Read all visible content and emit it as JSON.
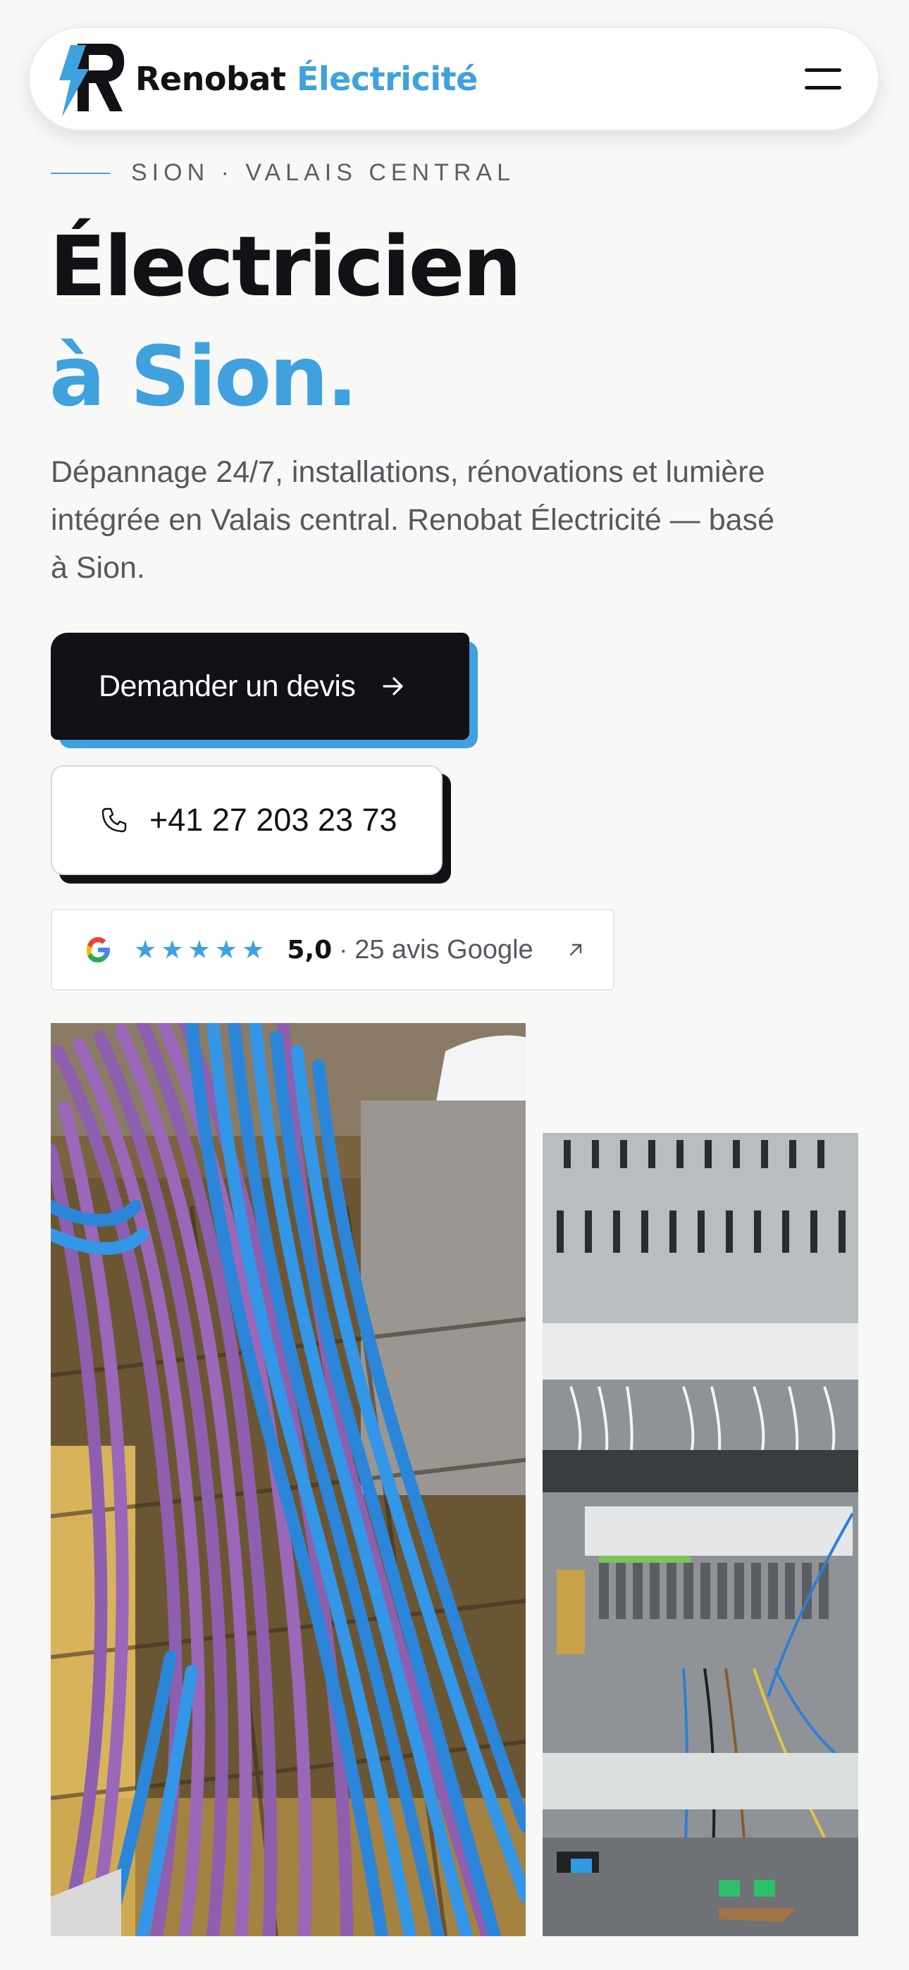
{
  "header": {
    "brand_part1": "Renobat",
    "brand_part2": "Électricité",
    "logo_icon": "lightning-r-logo",
    "menu_icon": "hamburger-icon"
  },
  "hero": {
    "eyebrow": "SION · VALAIS CENTRAL",
    "title_line1": "Électricien",
    "title_line2": "à Sion.",
    "lead": "Dépannage 24/7, installations, rénovations et lumière intégrée en Valais central. Renobat Électricité — basé à Sion.",
    "cta_label": "Demander un devis",
    "cta_icon": "arrow-right-icon",
    "phone_label": "+41 27 203 23 73",
    "phone_icon": "phone-icon"
  },
  "reviews": {
    "google_icon": "google-g-icon",
    "stars": 5,
    "rating": "5,0",
    "separator": "·",
    "count_label": "25 avis Google",
    "external_icon": "arrow-up-right-icon"
  },
  "colors": {
    "accent": "#3fa1dd",
    "dark": "#111116",
    "background": "#f8f8f7",
    "muted_text": "#55585f"
  }
}
